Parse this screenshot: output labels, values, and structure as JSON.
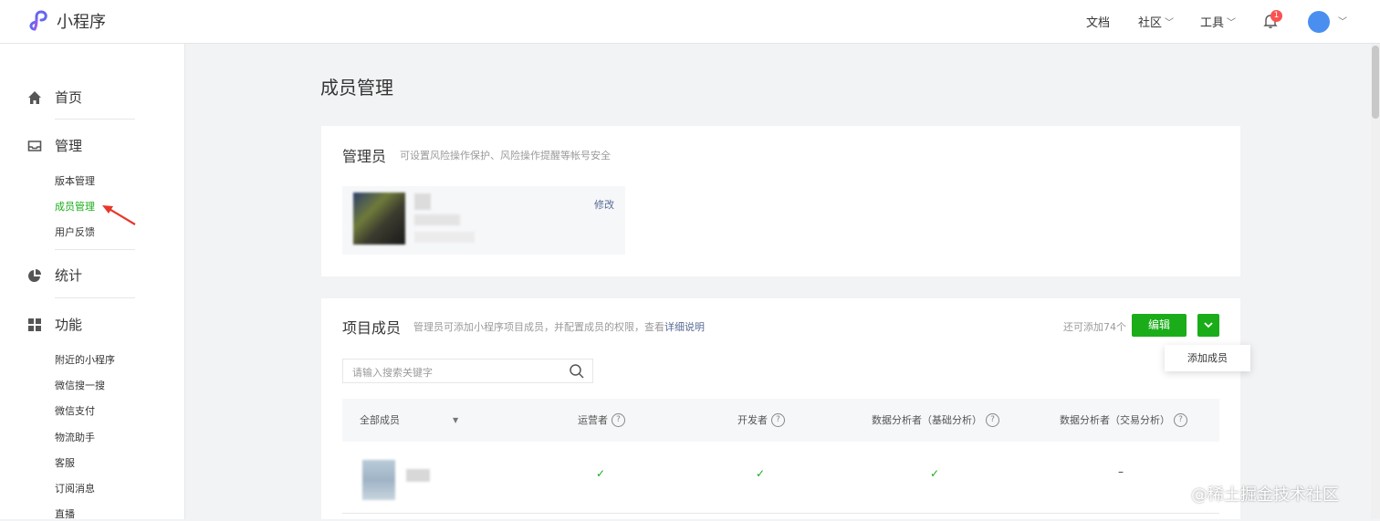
{
  "header": {
    "app_title": "小程序",
    "nav": [
      "文档",
      "社区",
      "工具"
    ],
    "notification_count": "1",
    "icons": [
      "logo-icon",
      "bell-icon",
      "avatar",
      "chevron-down-icon"
    ]
  },
  "sidebar": {
    "groups": [
      {
        "label": "首页",
        "icon": "home-icon"
      },
      {
        "label": "管理",
        "icon": "inbox-icon"
      },
      {
        "label": "统计",
        "icon": "pie-chart-icon"
      },
      {
        "label": "功能",
        "icon": "grid-icon"
      }
    ],
    "manage_items": [
      "版本管理",
      "成员管理",
      "用户反馈"
    ],
    "feature_items": [
      "附近的小程序",
      "微信搜一搜",
      "微信支付",
      "物流助手",
      "客服",
      "订阅消息",
      "直播"
    ],
    "active_item": "成员管理",
    "accent_color": "#1aad19"
  },
  "main": {
    "page_title": "成员管理",
    "admin": {
      "title": "管理员",
      "tip": "可设置风险操作保护、风险操作提醒等帐号安全",
      "modify_label": "修改"
    },
    "members": {
      "title": "项目成员",
      "tip_prefix": "管理员可添加小程序项目成员，并配置成员的权限，查看",
      "tip_link": "详细说明",
      "remaining": "还可添加74个",
      "edit_label": "编辑",
      "dropdown_item": "添加成员",
      "search_placeholder": "请输入搜索关键字",
      "columns": [
        "全部成员",
        "运营者",
        "开发者",
        "数据分析者（基础分析）",
        "数据分析者（交易分析）"
      ],
      "rows": [
        {
          "cells": [
            "✓",
            "✓",
            "✓",
            "–"
          ]
        }
      ]
    }
  },
  "watermark": "@稀土掘金技术社区"
}
